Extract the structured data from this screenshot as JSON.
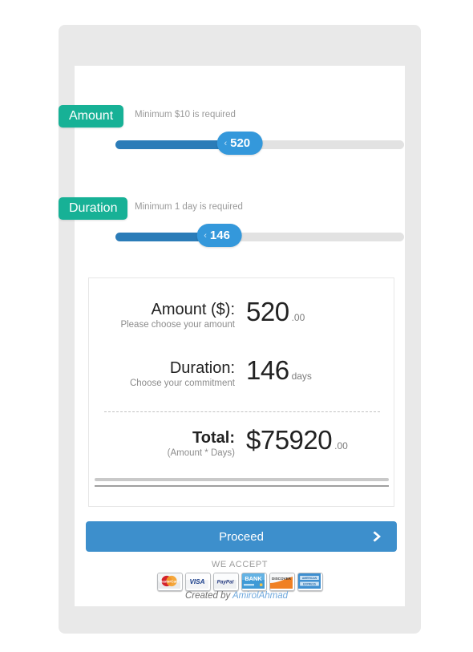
{
  "amount_field": {
    "badge": "Amount",
    "hint": "Minimum $10 is required",
    "value": "520",
    "chevron": "‹",
    "fill_percent": 43
  },
  "duration_field": {
    "badge": "Duration",
    "hint": "Minimum 1 day is required",
    "value": "146",
    "chevron": "‹",
    "fill_percent": 36
  },
  "summary": {
    "amount": {
      "title": "Amount ($):",
      "subtitle": "Please choose your amount",
      "value": "520",
      "unit": ".00"
    },
    "duration": {
      "title": "Duration:",
      "subtitle": "Choose your commitment",
      "value": "146",
      "unit": "days"
    },
    "total": {
      "title": "Total:",
      "subtitle": "(Amount * Days)",
      "value": "$75920",
      "unit": ".00"
    }
  },
  "actions": {
    "proceed_label": "Proceed",
    "proceed_arrow_icon": "chevron-right-icon"
  },
  "payment": {
    "accept_label": "WE ACCEPT",
    "methods": [
      {
        "name": "mastercard",
        "label": "MasterCard"
      },
      {
        "name": "visa",
        "label": "VISA"
      },
      {
        "name": "paypal",
        "label": "PayPal"
      },
      {
        "name": "bank",
        "label": "BANK"
      },
      {
        "name": "discover",
        "label": "DISCOVER"
      },
      {
        "name": "amex",
        "label": "AMERICAN EXPRESS"
      }
    ]
  },
  "footer": {
    "credit_prefix": "Created by ",
    "author": "AmirolAhmad"
  },
  "colors": {
    "badge_green": "#17b196",
    "slider_fill": "#2b7cb8",
    "slider_handle": "#3498db",
    "proceed_blue": "#3d8fcc",
    "shell_gray": "#e9e9e9",
    "author_link": "#6fa8dc"
  }
}
